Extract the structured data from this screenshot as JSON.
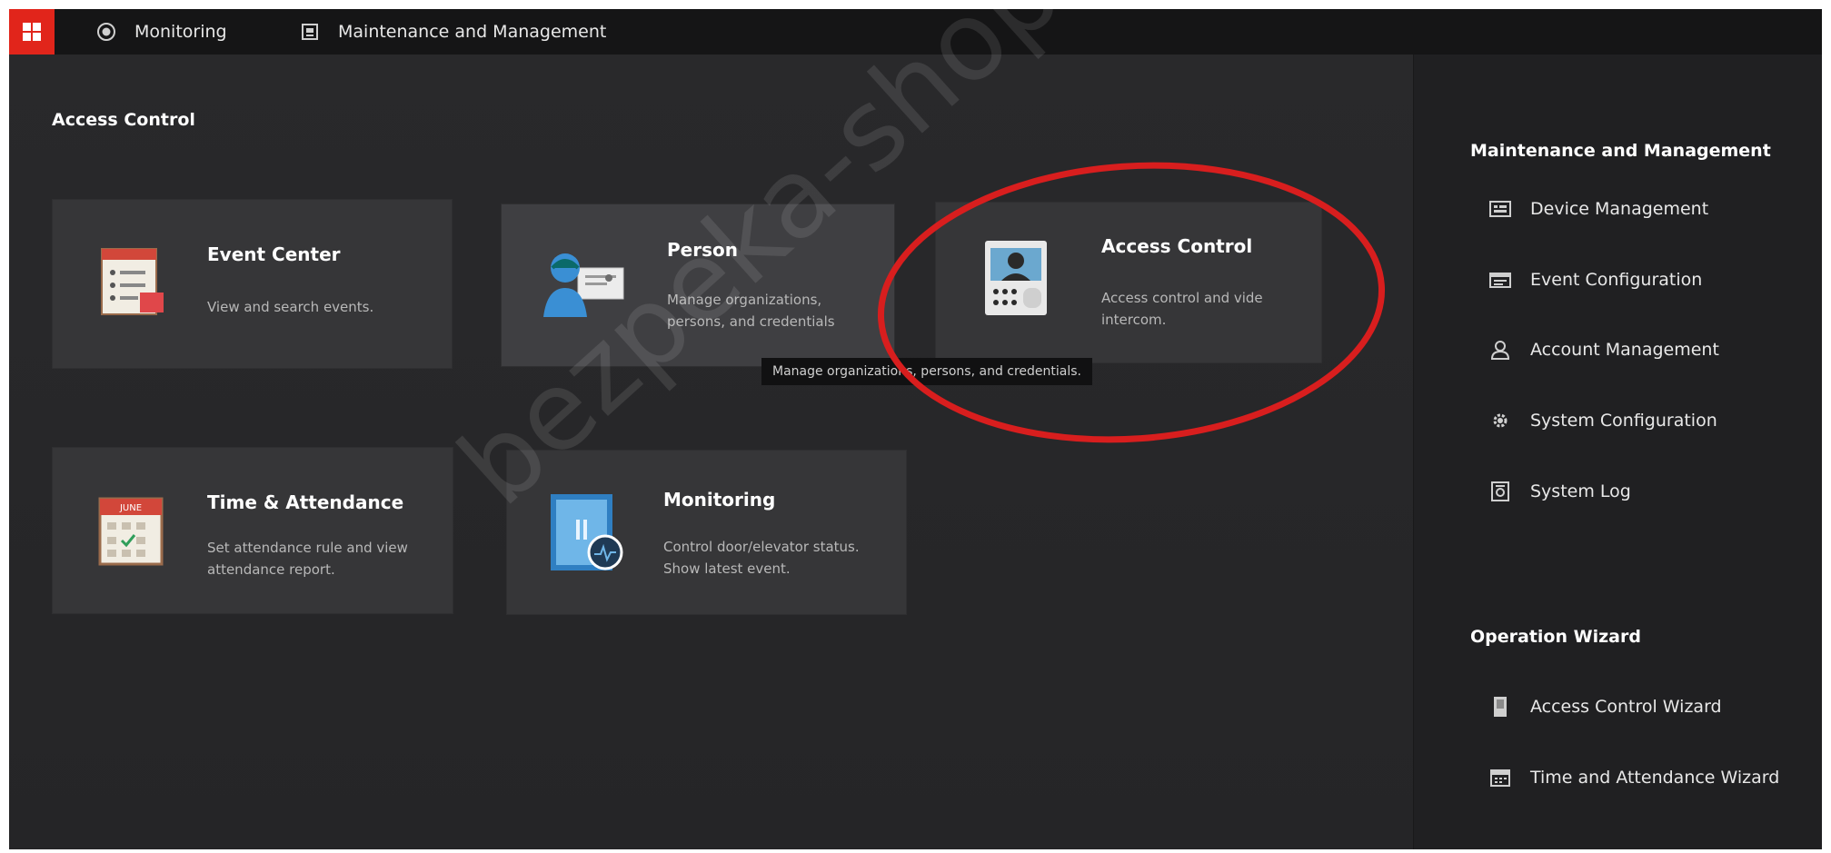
{
  "topbar": {
    "tabs": [
      {
        "label": "Monitoring",
        "icon": "monitoring-icon"
      },
      {
        "label": "Maintenance and Management",
        "icon": "maintenance-icon"
      }
    ]
  },
  "main": {
    "section_title": "Access Control",
    "cards": [
      {
        "title": "Event Center",
        "desc": "View and search events.",
        "icon": "event-center-icon"
      },
      {
        "title": "Person",
        "desc": "Manage organizations, persons, and credentials",
        "icon": "person-icon"
      },
      {
        "title": "Access Control",
        "desc": "Access control and vide intercom.",
        "icon": "access-control-icon"
      },
      {
        "title": "Time & Attendance",
        "desc": "Set attendance rule and view attendance report.",
        "icon": "time-attendance-icon"
      },
      {
        "title": "Monitoring",
        "desc": "Control door/elevator status. Show latest event.",
        "icon": "monitoring-door-icon"
      }
    ],
    "tooltip": "Manage organizations, persons, and credentials."
  },
  "panel": {
    "maintenance": {
      "title": "Maintenance and Management",
      "items": [
        {
          "label": "Device Management",
          "icon": "device-management-icon"
        },
        {
          "label": "Event Configuration",
          "icon": "event-configuration-icon"
        },
        {
          "label": "Account Management",
          "icon": "account-icon"
        },
        {
          "label": "System Configuration",
          "icon": "gear-icon"
        },
        {
          "label": "System Log",
          "icon": "log-icon"
        }
      ]
    },
    "wizard": {
      "title": "Operation Wizard",
      "items": [
        {
          "label": "Access Control Wizard",
          "icon": "door-icon"
        },
        {
          "label": "Time and Attendance Wizard",
          "icon": "calendar-icon"
        }
      ]
    }
  },
  "watermark": "bezpeka-shop.com",
  "colors": {
    "accent": "#e1251b",
    "annotation": "#d81e1e",
    "background": "#262628",
    "panel": "#202022"
  }
}
